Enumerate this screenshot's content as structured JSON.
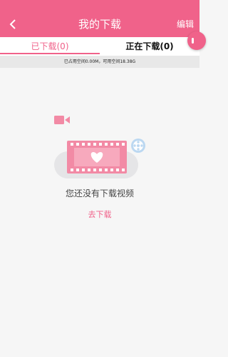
{
  "header": {
    "title": "我的下载",
    "edit_label": "编辑",
    "back_icon": "chevron-left-icon"
  },
  "tabs": [
    {
      "label": "已下载(0)",
      "active": true
    },
    {
      "label": "正在下载(0)",
      "active": false
    }
  ],
  "storage_info": "已占用空间0.00M，可用空间18.38G",
  "empty_state": {
    "message": "您还没有下载视频",
    "action_label": "去下载"
  },
  "colors": {
    "accent": "#f0628a",
    "storage_bar": "#e8e8e8",
    "background": "#f6f6f6"
  }
}
